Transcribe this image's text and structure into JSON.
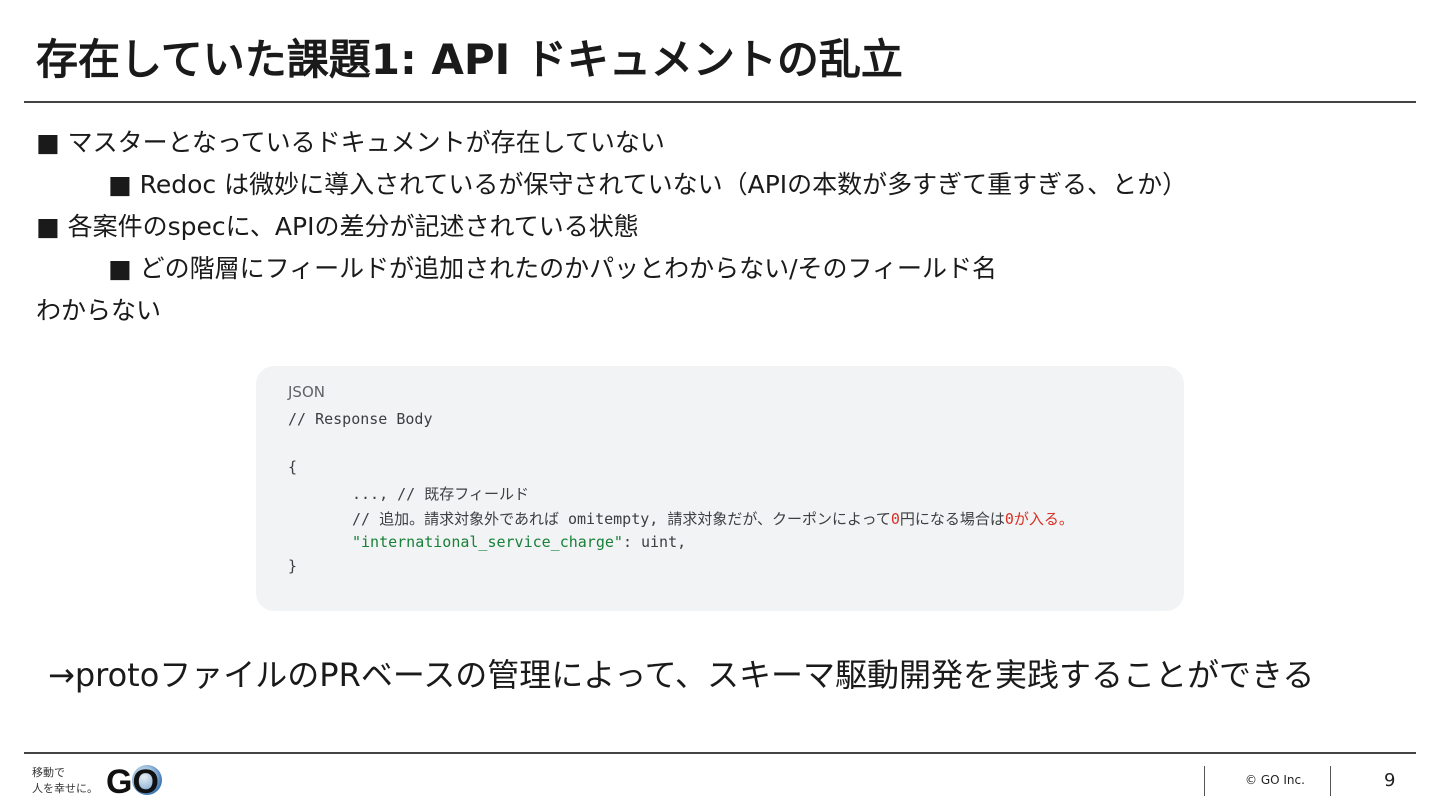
{
  "slide": {
    "title": "存在していた課題1: API ドキュメントの乱立",
    "bullets": [
      {
        "marker": "■",
        "text": "マスターとなっているドキュメントが存在していない"
      },
      {
        "marker": "■",
        "text": "Redoc は微妙に導入されているが保守されていない（APIの本数が多すぎて重すぎる、とか）"
      },
      {
        "marker": "■",
        "text": "各案件のspecに、APIの差分が記述されている状態"
      },
      {
        "marker": "■",
        "text": "どの階層にフィールドが追加されたのかパッとわからない/そのフィールド名"
      },
      {
        "marker": "",
        "text": "わからない"
      }
    ],
    "code": {
      "language": "JSON",
      "line_comment": "// Response Body",
      "open_brace": "{",
      "line_existing": "..., // 既存フィールド",
      "line_added_prefix": "// 追加。請求対象外であれば omitempty, 請求対象だが、クーポンによって",
      "line_added_zero1": "0",
      "line_added_mid": "円になる場合は",
      "line_added_zero2": "0",
      "line_added_suffix": "が入る。",
      "field_key": "\"international_service_charge\"",
      "field_rest": ": uint,",
      "close_brace": "}"
    },
    "conclusion": "→protoファイルのPRベースの管理によって、スキーマ駆動開発を実践することができる"
  },
  "footer": {
    "slogan_line1": "移動で",
    "slogan_line2": "人を幸せに。",
    "logo_text": "GO",
    "copyright": "© GO Inc.",
    "page_number": "9"
  },
  "colors": {
    "code_background": "#f1f3f4",
    "code_zero": "#d93025",
    "code_string": "#188038",
    "logo_accent": "#5b8fc9"
  }
}
